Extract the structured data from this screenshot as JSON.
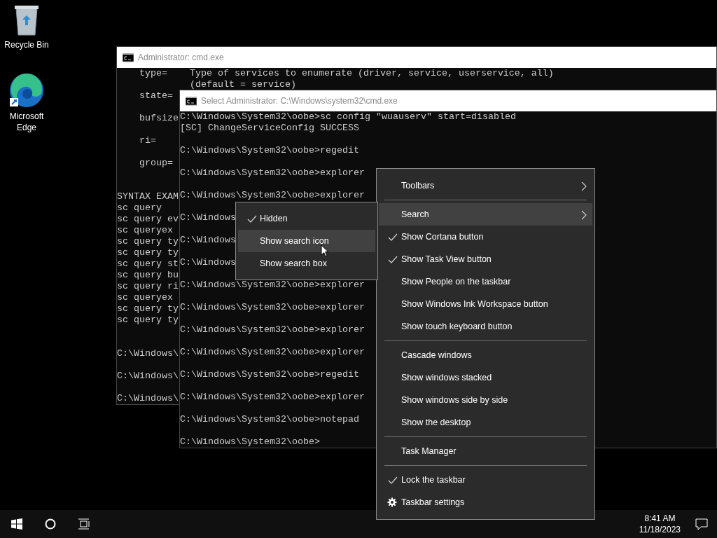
{
  "desktop_icons": [
    {
      "kind": "recycle-bin",
      "label": "Recycle Bin"
    },
    {
      "kind": "browser",
      "label": "Microsoft Edge"
    }
  ],
  "windows": [
    {
      "title": "Administrator: cmd.exe",
      "lines": [
        {
          "kind": "text",
          "text": "    type=    Type of services to enumerate (driver, service, userservice, all)"
        },
        {
          "kind": "text",
          "text": "             (default = service)"
        },
        {
          "kind": "text",
          "text": "    state="
        },
        {
          "kind": "blank"
        },
        {
          "kind": "text",
          "text": "    bufsize"
        },
        {
          "kind": "blank"
        },
        {
          "kind": "text",
          "text": "    ri="
        },
        {
          "kind": "blank"
        },
        {
          "kind": "text",
          "text": "    group="
        },
        {
          "kind": "blank"
        },
        {
          "kind": "blank"
        },
        {
          "kind": "text",
          "text": "SYNTAX EXAM"
        },
        {
          "kind": "text",
          "text": "sc query"
        },
        {
          "kind": "text",
          "text": "sc query ev"
        },
        {
          "kind": "text",
          "text": "sc queryex"
        },
        {
          "kind": "text",
          "text": "sc query ty"
        },
        {
          "kind": "text",
          "text": "sc query ty"
        },
        {
          "kind": "text",
          "text": "sc query st"
        },
        {
          "kind": "text",
          "text": "sc query bu"
        },
        {
          "kind": "text",
          "text": "sc query ri"
        },
        {
          "kind": "text",
          "text": "sc queryex"
        },
        {
          "kind": "text",
          "text": "sc query ty"
        },
        {
          "kind": "text",
          "text": "sc query ty"
        },
        {
          "kind": "blank"
        },
        {
          "kind": "blank"
        },
        {
          "kind": "text",
          "text": "C:\\Windows\\"
        },
        {
          "kind": "blank"
        },
        {
          "kind": "text",
          "text": "C:\\Windows\\"
        },
        {
          "kind": "blank"
        },
        {
          "kind": "text",
          "text": "C:\\Windows\\"
        }
      ]
    },
    {
      "title": "Select Administrator: C:\\Windows\\system32\\cmd.exe",
      "lines": [
        {
          "kind": "text",
          "text": "C:\\Windows\\System32\\oobe>sc config \"wuauserv\" start=disabled"
        },
        {
          "kind": "text",
          "text": "[SC] ChangeServiceConfig SUCCESS"
        },
        {
          "kind": "blank"
        },
        {
          "kind": "text",
          "text": "C:\\Windows\\System32\\oobe>regedit"
        },
        {
          "kind": "blank"
        },
        {
          "kind": "text",
          "text": "C:\\Windows\\System32\\oobe>explorer"
        },
        {
          "kind": "blank"
        },
        {
          "kind": "text",
          "text": "C:\\Windows\\System32\\oobe>explorer"
        },
        {
          "kind": "blank"
        },
        {
          "kind": "text",
          "text": "C:\\Windows"
        },
        {
          "kind": "blank"
        },
        {
          "kind": "text",
          "text": "C:\\Windows"
        },
        {
          "kind": "blank"
        },
        {
          "kind": "text",
          "text": "C:\\Windows"
        },
        {
          "kind": "blank"
        },
        {
          "kind": "text",
          "text": "C:\\Windows\\System32\\oobe>explorer"
        },
        {
          "kind": "blank"
        },
        {
          "kind": "text",
          "text": "C:\\Windows\\System32\\oobe>explorer"
        },
        {
          "kind": "blank"
        },
        {
          "kind": "text",
          "text": "C:\\Windows\\System32\\oobe>explorer"
        },
        {
          "kind": "blank"
        },
        {
          "kind": "text",
          "text": "C:\\Windows\\System32\\oobe>explorer"
        },
        {
          "kind": "blank"
        },
        {
          "kind": "text",
          "text": "C:\\Windows\\System32\\oobe>regedit"
        },
        {
          "kind": "blank"
        },
        {
          "kind": "text",
          "text": "C:\\Windows\\System32\\oobe>explorer"
        },
        {
          "kind": "blank"
        },
        {
          "kind": "text",
          "text": "C:\\Windows\\System32\\oobe>notepad"
        },
        {
          "kind": "blank"
        },
        {
          "kind": "text",
          "text": "C:\\Windows\\System32\\oobe>"
        }
      ]
    }
  ],
  "context_menu": {
    "items": [
      {
        "kind": "item",
        "label": "Toolbars",
        "checked": false,
        "selected": false,
        "submenu": true
      },
      {
        "kind": "separator"
      },
      {
        "kind": "item",
        "label": "Search",
        "checked": false,
        "selected": true,
        "submenu": true
      },
      {
        "kind": "item",
        "label": "Show Cortana button",
        "checked": true,
        "selected": false,
        "submenu": false
      },
      {
        "kind": "item",
        "label": "Show Task View button",
        "checked": true,
        "selected": false,
        "submenu": false
      },
      {
        "kind": "item",
        "label": "Show People on the taskbar",
        "checked": false,
        "selected": false,
        "submenu": false
      },
      {
        "kind": "item",
        "label": "Show Windows Ink Workspace button",
        "checked": false,
        "selected": false,
        "submenu": false
      },
      {
        "kind": "item",
        "label": "Show touch keyboard button",
        "checked": false,
        "selected": false,
        "submenu": false
      },
      {
        "kind": "separator"
      },
      {
        "kind": "item",
        "label": "Cascade windows",
        "checked": false,
        "selected": false,
        "submenu": false
      },
      {
        "kind": "item",
        "label": "Show windows stacked",
        "checked": false,
        "selected": false,
        "submenu": false
      },
      {
        "kind": "item",
        "label": "Show windows side by side",
        "checked": false,
        "selected": false,
        "submenu": false
      },
      {
        "kind": "item",
        "label": "Show the desktop",
        "checked": false,
        "selected": false,
        "submenu": false
      },
      {
        "kind": "separator"
      },
      {
        "kind": "item",
        "label": "Task Manager",
        "checked": false,
        "selected": false,
        "submenu": false
      },
      {
        "kind": "separator"
      },
      {
        "kind": "item",
        "label": "Lock the taskbar",
        "checked": true,
        "selected": false,
        "submenu": false
      },
      {
        "kind": "settings",
        "label": "Taskbar settings",
        "selected": false,
        "submenu": false
      }
    ]
  },
  "submenu": {
    "items": [
      {
        "kind": "item",
        "label": "Hidden",
        "checked": true,
        "selected": false,
        "submenu": false
      },
      {
        "kind": "item",
        "label": "Show search icon",
        "checked": false,
        "selected": true,
        "submenu": false
      },
      {
        "kind": "item",
        "label": "Show search box",
        "checked": false,
        "selected": false,
        "submenu": false
      }
    ]
  },
  "taskbar": {
    "time": "8:41 AM",
    "date": "11/18/2023"
  }
}
